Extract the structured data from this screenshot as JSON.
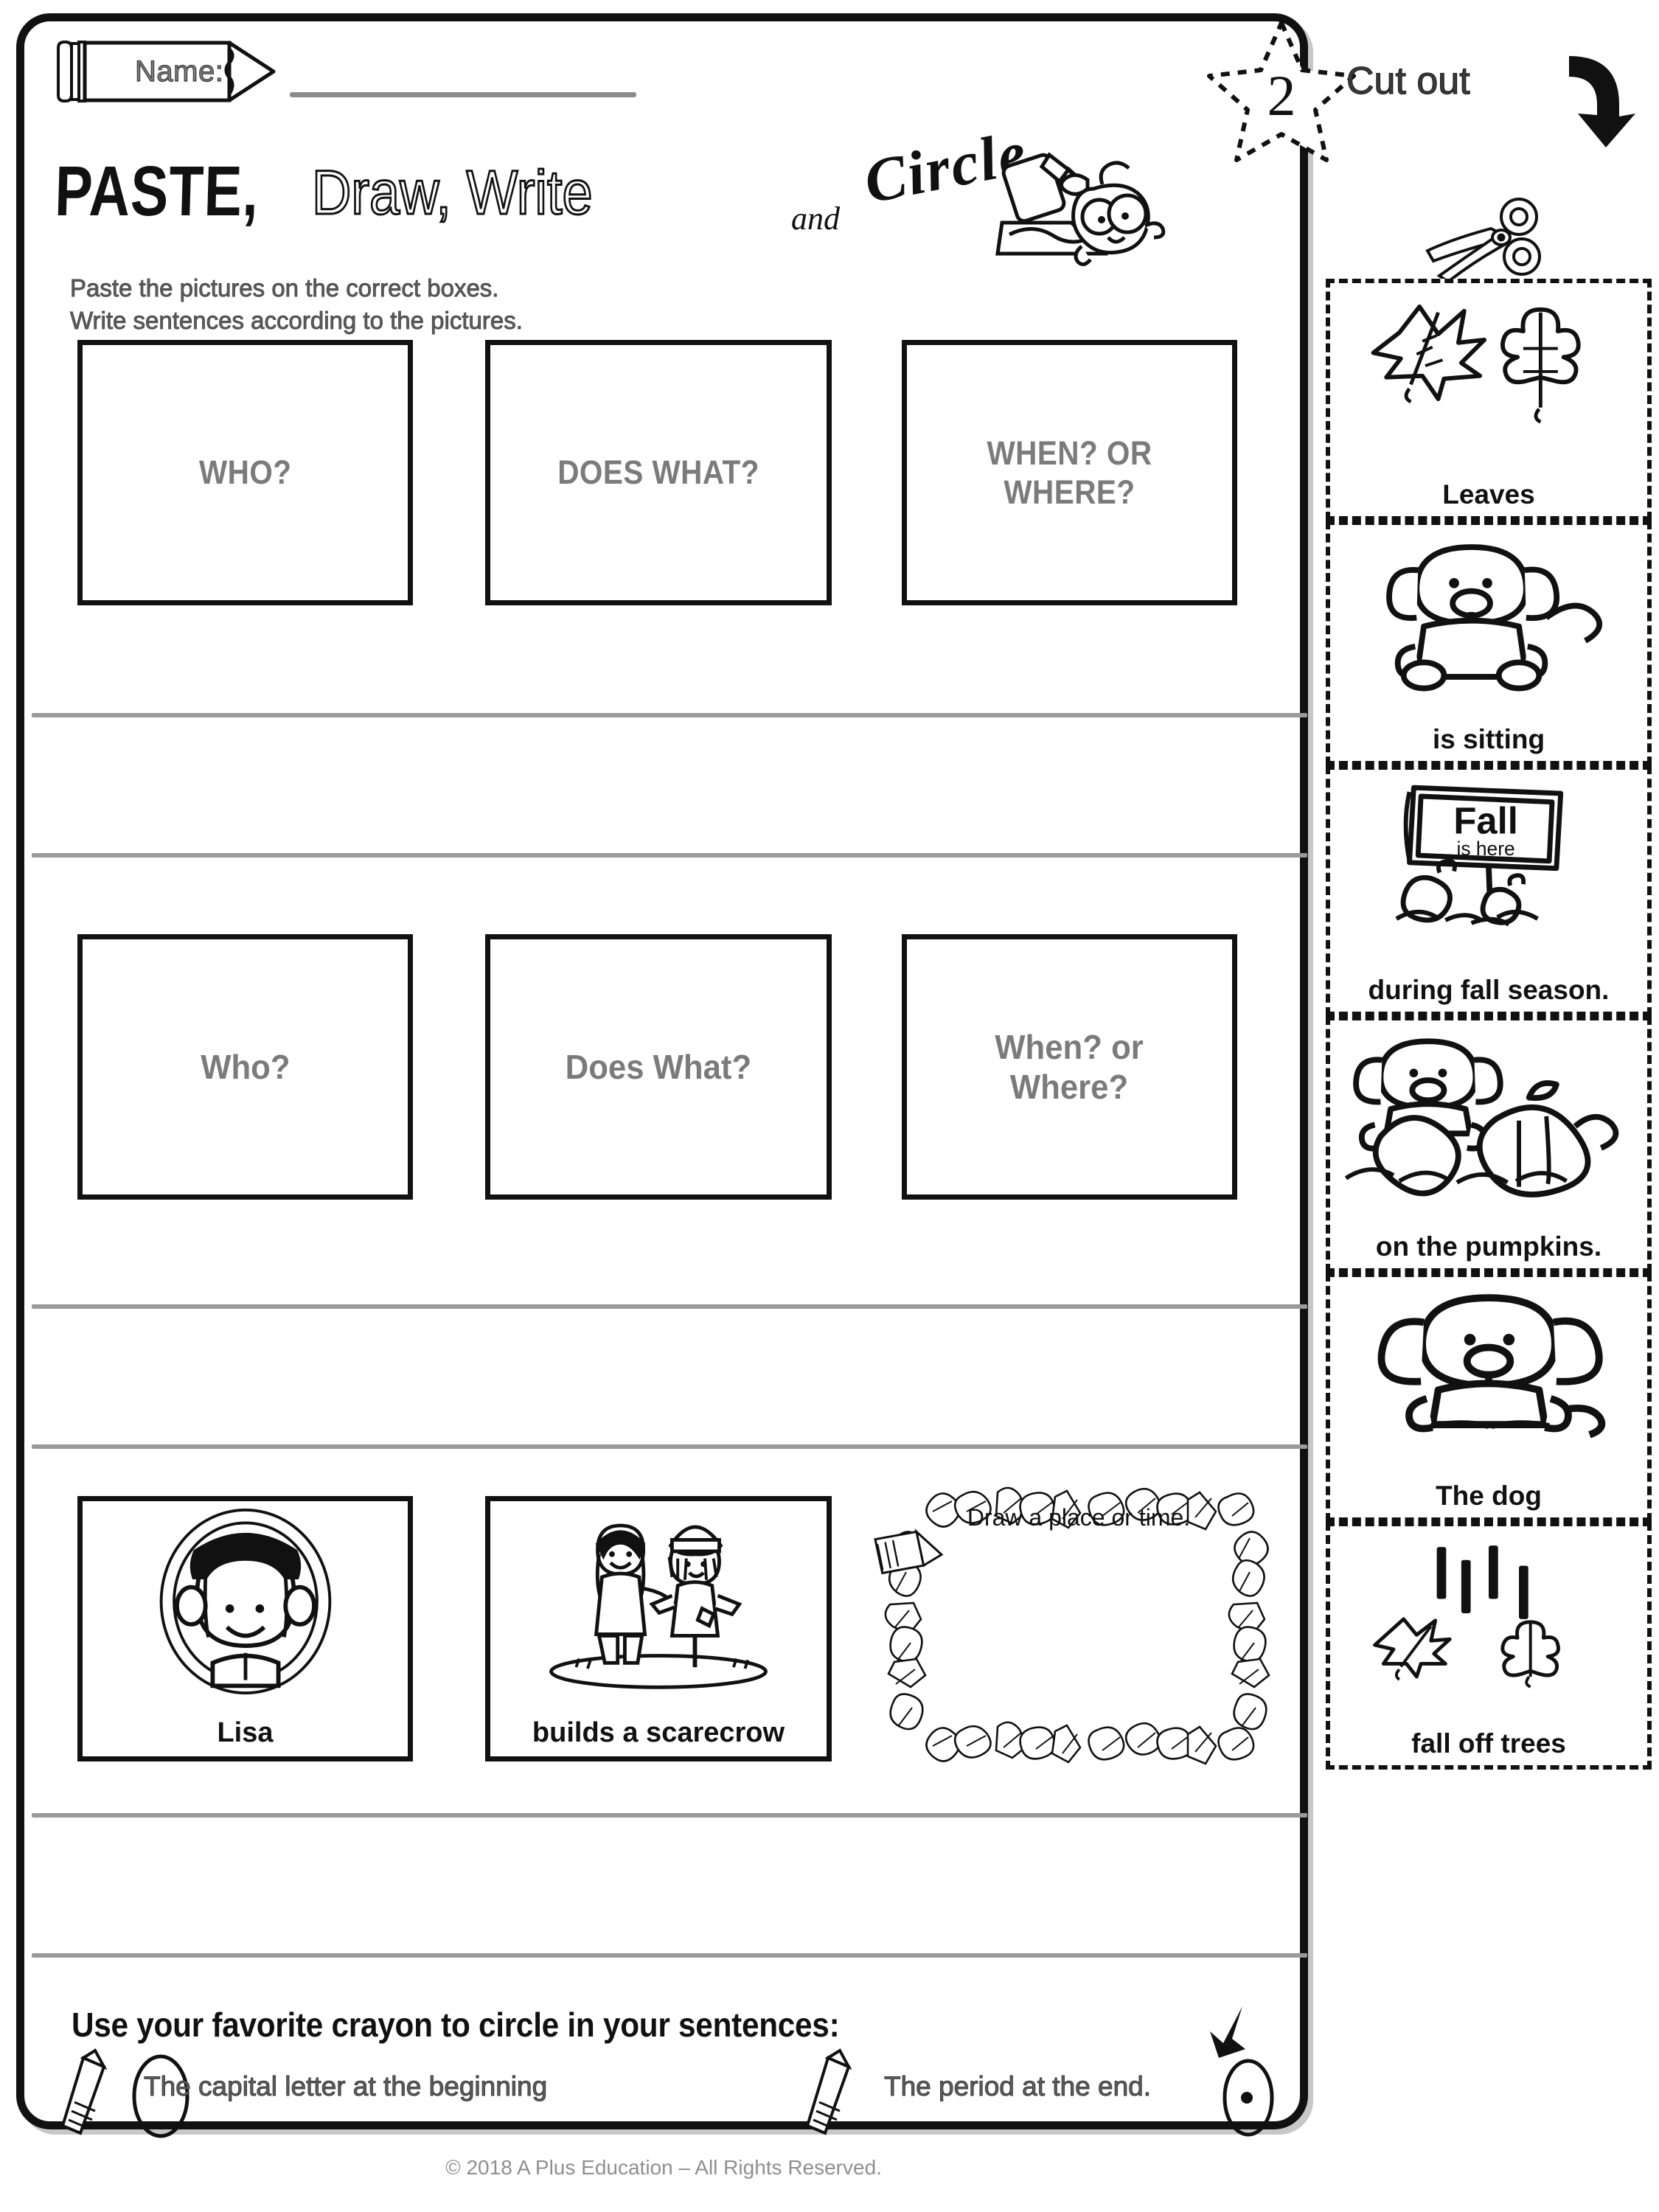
{
  "page": {
    "number": "2",
    "copyright": "© 2018 A Plus Education – All Rights Reserved."
  },
  "header": {
    "name_label": "Name:",
    "title_paste": "PASTE,",
    "title_draw": "Draw, Write",
    "title_and": "and",
    "title_circle": "Circle"
  },
  "instructions": {
    "line1": "Paste the pictures on the correct boxes.",
    "line2": "Write sentences according to the pictures."
  },
  "rows": [
    {
      "id": "row-uppercase",
      "boxes": [
        {
          "label": "WHO?"
        },
        {
          "label": "DOES WHAT?"
        },
        {
          "label_line1": "WHEN? OR",
          "label_line2": "WHERE?"
        }
      ]
    },
    {
      "id": "row-mixedcase",
      "boxes": [
        {
          "label": "Who?"
        },
        {
          "label": "Does What?"
        },
        {
          "label_line1": "When? or",
          "label_line2": "Where?"
        }
      ]
    },
    {
      "id": "row-pictures",
      "boxes": [
        {
          "caption": "Lisa",
          "art": "girl-face-icon"
        },
        {
          "caption": "builds a scarecrow",
          "art": "girl-and-scarecrow-icon"
        },
        {
          "caption": "Draw a place or time.",
          "art": "leaf-border-frame"
        }
      ]
    }
  ],
  "bottom": {
    "title": "Use your favorite crayon to circle in your sentences:",
    "item1": "The capital letter at the beginning",
    "item2": "The period at the end.",
    "item1_highlight": "T",
    "item2_highlight": "."
  },
  "cutout": {
    "title": "Cut out",
    "scissors_icon": "scissors-icon",
    "arrow_icon": "curved-arrow-icon",
    "cards": [
      {
        "label": "Leaves",
        "art": "two-leaves-icon"
      },
      {
        "label": "is sitting",
        "art": "dog-sitting-icon"
      },
      {
        "label": "during fall season.",
        "art": "fall-is-here-sign-icon",
        "sign_line1": "Fall",
        "sign_line2": "is here"
      },
      {
        "label": "on the pumpkins.",
        "art": "dog-on-pumpkins-icon"
      },
      {
        "label": "The dog",
        "art": "dog-standing-icon"
      },
      {
        "label": "fall off trees",
        "art": "falling-leaves-icon"
      }
    ]
  },
  "colors": {
    "ink": "#111111",
    "gray_label": "#7b7b7b",
    "line_gray": "#9a9a9a"
  }
}
